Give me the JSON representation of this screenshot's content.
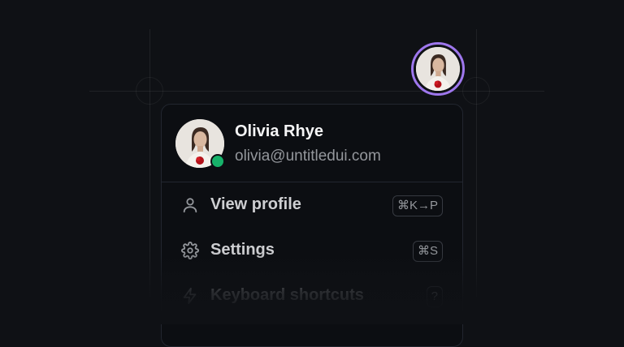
{
  "user": {
    "name": "Olivia Rhye",
    "email": "olivia@untitledui.com",
    "status": "online"
  },
  "menu": {
    "items": [
      {
        "label": "View profile",
        "icon": "user-icon",
        "shortcut": "⌘K→P"
      },
      {
        "label": "Settings",
        "icon": "gear-icon",
        "shortcut": "⌘S"
      },
      {
        "label": "Keyboard shortcuts",
        "icon": "zap-icon",
        "shortcut": "?"
      }
    ]
  },
  "colors": {
    "background": "#0f1115",
    "avatar_ring": "#9e77ed",
    "online": "#17b26a",
    "text_primary": "#f5f5f6",
    "text_secondary": "#94979c"
  }
}
